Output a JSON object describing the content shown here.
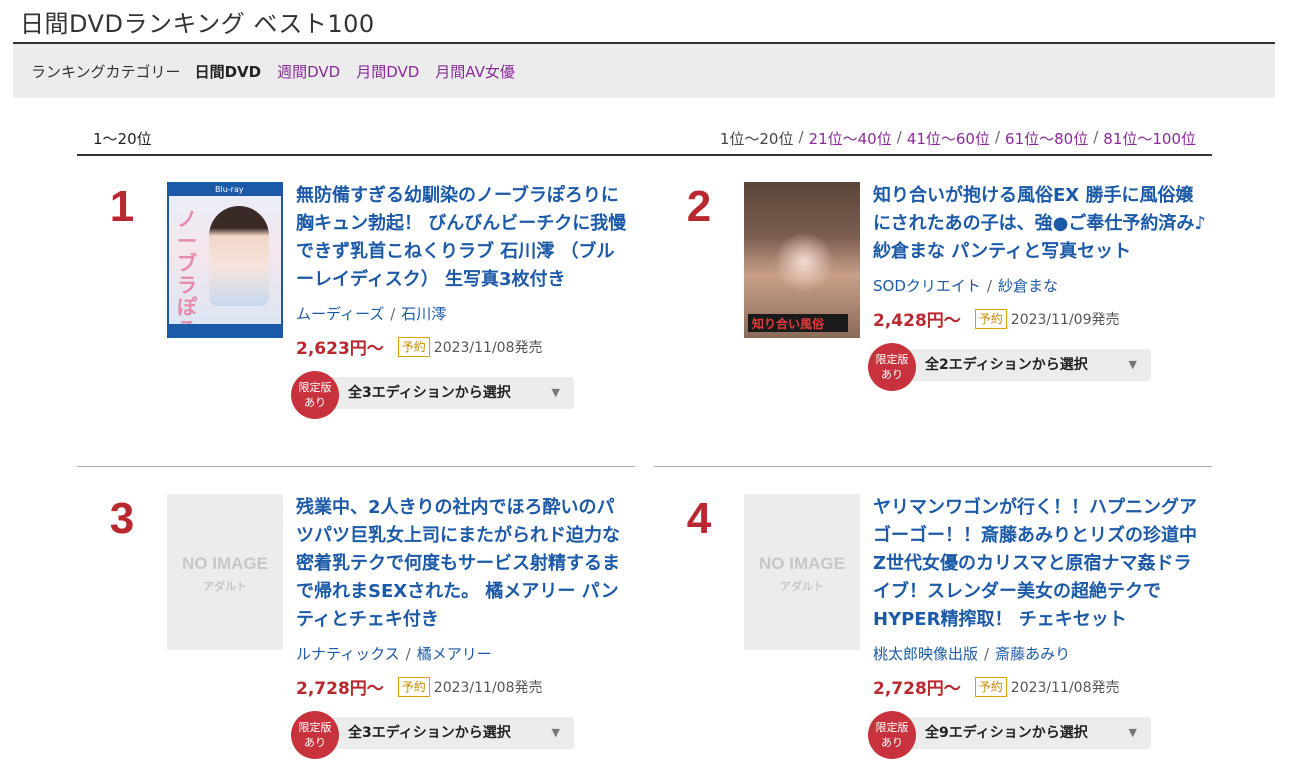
{
  "page_title": "日間DVDランキング ベスト100",
  "category_bar": {
    "label": "ランキングカテゴリー",
    "items": [
      {
        "label": "日間DVD",
        "active": true
      },
      {
        "label": "週間DVD",
        "active": false
      },
      {
        "label": "月間DVD",
        "active": false
      },
      {
        "label": "月間AV女優",
        "active": false
      }
    ]
  },
  "range": {
    "current": "1～20位",
    "pages": [
      "1位～20位",
      "21位～40位",
      "41位～60位",
      "61位～80位",
      "81位～100位"
    ],
    "separator": "/"
  },
  "items": [
    {
      "rank": "1",
      "thumb": "bluray-cover",
      "thumb_text": "ノーブラぽろり",
      "title": "無防備すぎる幼馴染のノーブラぽろりに胸キュン勃起！ びんびんビーチクに我慢できず乳首こねくりラブ 石川澪 （ブルーレイディスク） 生写真3枚付き",
      "maker": "ムーディーズ",
      "actress": "石川澪",
      "price": "2,623円～",
      "badge": "予約",
      "release": "2023/11/08発売",
      "limited": "限定版あり",
      "edition": "全3エディションから選択"
    },
    {
      "rank": "2",
      "thumb": "photo-cover",
      "thumb_text": "知り合い風俗",
      "title": "知り合いが抱ける風俗EX 勝手に風俗嬢にされたあの子は、強●ご奉仕予約済み♪ 紗倉まな パンティと写真セット",
      "maker": "SODクリエイト",
      "actress": "紗倉まな",
      "price": "2,428円～",
      "badge": "予約",
      "release": "2023/11/09発売",
      "limited": "限定版あり",
      "edition": "全2エディションから選択"
    },
    {
      "rank": "3",
      "thumb": "no-image",
      "noimage_main": "NO IMAGE",
      "noimage_sub": "アダルト",
      "title": "残業中、2人きりの社内でほろ酔いのパツパツ巨乳女上司にまたがられド迫力な密着乳テクで何度もサービス射精するまで帰れまSEXされた。 橘メアリー パンティとチェキ付き",
      "maker": "ルナティックス",
      "actress": "橘メアリー",
      "price": "2,728円～",
      "badge": "予約",
      "release": "2023/11/08発売",
      "limited": "限定版あり",
      "edition": "全3エディションから選択"
    },
    {
      "rank": "4",
      "thumb": "no-image",
      "noimage_main": "NO IMAGE",
      "noimage_sub": "アダルト",
      "title": "ヤリマンワゴンが行く！！ハプニングア ゴーゴー！！斎藤あみりとリズの珍道中 Z世代女優のカリスマと原宿ナマ姦ドライブ！スレンダー美女の超絶テクでHYPER精搾取！ チェキセット",
      "maker": "桃太郎映像出版",
      "actress": "斎藤あみり",
      "price": "2,728円～",
      "badge": "予約",
      "release": "2023/11/08発売",
      "limited": "限定版あり",
      "edition": "全9エディションから選択"
    }
  ],
  "colors": {
    "rank_red": "#b8282e",
    "link_blue": "#1c5aa8",
    "nav_purple": "#8a2a9a",
    "limited_red": "#c8323c",
    "yoyaku_orange": "#e0a000"
  }
}
